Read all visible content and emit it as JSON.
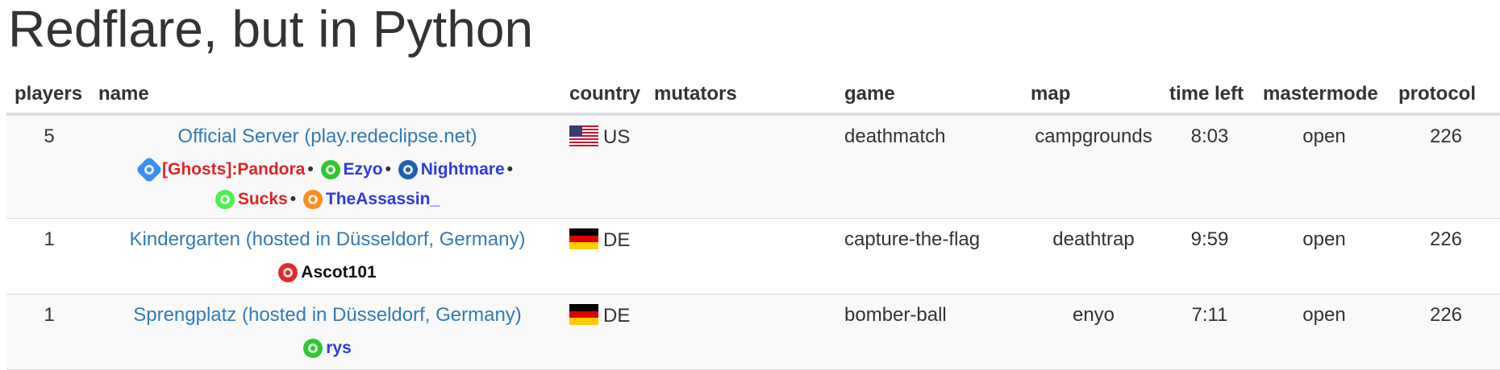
{
  "page": {
    "title": "Redflare, but in Python"
  },
  "table": {
    "headers": {
      "players": "players",
      "name": "name",
      "country": "country",
      "mutators": "mutators",
      "game": "game",
      "map": "map",
      "time_left": "time left",
      "mastermode": "mastermode",
      "protocol": "protocol"
    },
    "rows": [
      {
        "players": "5",
        "name": "Official Server (play.redeclipse.net)",
        "country_flag": "us-flag-icon",
        "country": "US",
        "mutators": "",
        "game": "deathmatch",
        "map": "campgrounds",
        "time_left": "8:03",
        "mastermode": "open",
        "protocol": "226",
        "players_list": [
          {
            "name": "[Ghosts]:Pandora",
            "icon": "blue-spinner-icon",
            "color": "#e42222"
          },
          {
            "name": "Ezyo",
            "icon": "green-player-icon",
            "color": "#2e3be0"
          },
          {
            "name": "Nightmare",
            "icon": "blue-player-icon",
            "color": "#2e3be0"
          },
          {
            "name": "Sucks",
            "icon": "light-green-player-icon",
            "color": "#e42222"
          },
          {
            "name": "TheAssassin_",
            "icon": "orange-player-icon",
            "color": "#2e3be0"
          }
        ],
        "separator": "•"
      },
      {
        "players": "1",
        "name": "Kindergarten (hosted in Düsseldorf, Germany)",
        "country_flag": "de-flag-icon",
        "country": "DE",
        "mutators": "",
        "game": "capture-the-flag",
        "map": "deathtrap",
        "time_left": "9:59",
        "mastermode": "open",
        "protocol": "226",
        "players_list": [
          {
            "name": "Ascot101",
            "icon": "red-player-icon",
            "color": "#111111"
          }
        ]
      },
      {
        "players": "1",
        "name": "Sprengplatz (hosted in Düsseldorf, Germany)",
        "country_flag": "de-flag-icon",
        "country": "DE",
        "mutators": "",
        "game": "bomber-ball",
        "map": "enyo",
        "time_left": "7:11",
        "mastermode": "open",
        "protocol": "226",
        "players_list": [
          {
            "name": "rys",
            "icon": "green-player-icon",
            "color": "#2e3be0"
          }
        ]
      }
    ]
  }
}
